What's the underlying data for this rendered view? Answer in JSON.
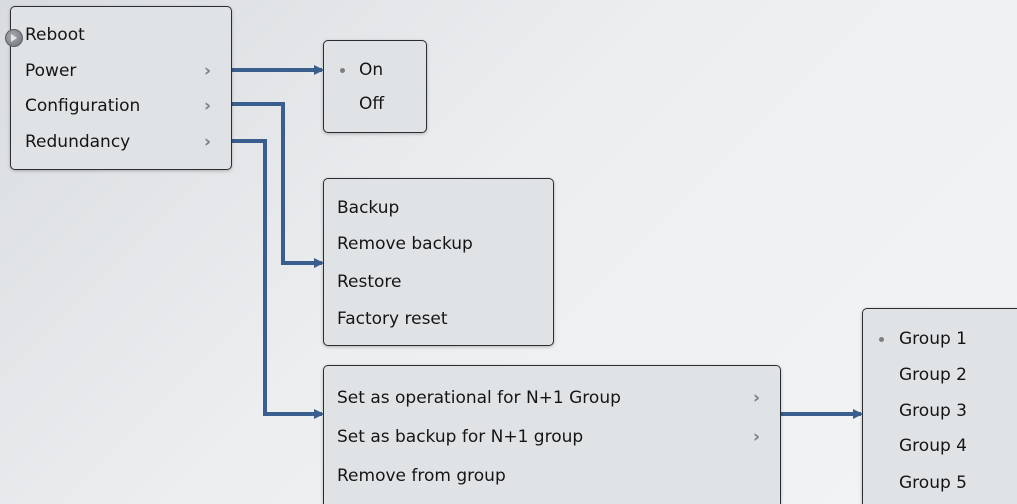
{
  "main_menu": {
    "items": [
      {
        "label": "Reboot",
        "submenu": false
      },
      {
        "label": "Power",
        "submenu": true
      },
      {
        "label": "Configuration",
        "submenu": true
      },
      {
        "label": "Redundancy",
        "submenu": true
      }
    ]
  },
  "power_menu": {
    "items": [
      {
        "label": "On",
        "selected": true
      },
      {
        "label": "Off",
        "selected": false
      }
    ]
  },
  "configuration_menu": {
    "items": [
      {
        "label": "Backup"
      },
      {
        "label": "Remove backup"
      },
      {
        "label": "Restore"
      },
      {
        "label": "Factory reset"
      }
    ]
  },
  "redundancy_menu": {
    "items": [
      {
        "label": "Set as operational for N+1 Group",
        "submenu": true
      },
      {
        "label": "Set as backup for N+1 group",
        "submenu": true
      },
      {
        "label": "Remove from group",
        "submenu": false
      }
    ]
  },
  "group_menu": {
    "items": [
      {
        "label": "Group 1",
        "selected": true
      },
      {
        "label": "Group 2",
        "selected": false
      },
      {
        "label": "Group 3",
        "selected": false
      },
      {
        "label": "Group 4",
        "selected": false
      },
      {
        "label": "Group 5",
        "selected": false
      }
    ]
  },
  "colors": {
    "connector": "#3a5f8f",
    "menu_background": "#e0e3e6",
    "menu_border": "#2a2d31"
  },
  "icons": {
    "submenu": "chevron-right-icon",
    "selected": "radio-dot-icon",
    "handle": "expand-handle-icon"
  }
}
